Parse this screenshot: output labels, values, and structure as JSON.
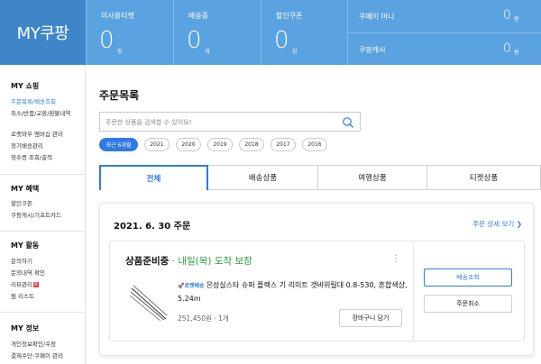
{
  "header": {
    "logo": "MY쿠팡",
    "stats": [
      {
        "label": "미사용티켓",
        "value": "0",
        "unit": "장"
      },
      {
        "label": "배송중",
        "value": "0",
        "unit": "개"
      },
      {
        "label": "할인쿠폰",
        "value": "0",
        "unit": "장"
      }
    ],
    "cash": [
      {
        "label": "쿠페이 머니",
        "value": "0",
        "unit": "원"
      },
      {
        "label": "쿠팡캐시",
        "value": "0",
        "unit": "원"
      }
    ]
  },
  "sidebar": {
    "sections": [
      {
        "title": "MY 쇼핑",
        "items": [
          "주문목록/배송조회",
          "취소/반품/교환/환불내역",
          "로켓와우 멤버십 관리",
          "정기배송관리",
          "영수증 조회/출력"
        ]
      },
      {
        "title": "MY 혜택",
        "items": [
          "할인쿠폰",
          "쿠팡캐시/기프트카드"
        ]
      },
      {
        "title": "MY 활동",
        "items": [
          "문의하기",
          "문의내역 확인",
          "리뷰관리",
          "찜 리스트"
        ]
      },
      {
        "title": "MY 정보",
        "items": [
          "개인정보확인/수정",
          "결제수단·쿠페이 관리"
        ]
      }
    ],
    "new_badge": "N"
  },
  "main": {
    "title": "주문목록",
    "search": {
      "placeholder": "주문한 상품을 검색할 수 있어요!",
      "value": ""
    },
    "periods": [
      "최근 6개월",
      "2021",
      "2020",
      "2019",
      "2018",
      "2017",
      "2016"
    ],
    "tabs": [
      "전체",
      "배송상품",
      "여행상품",
      "티켓상품"
    ],
    "order": {
      "date": "2021. 6. 30 주문",
      "detail_link": "주문 상세 보기 ❯",
      "status_bold": "상품준비중",
      "status_sep": " · ",
      "status_green": "내일(목) 도착 보장",
      "kebab": "⋮",
      "rocket": "🚀로켓배송",
      "product_name": "은성실스타 슈퍼 플렉스 기 리미트 갯바위릴대 0.8-530, 혼합색상, 5.24m",
      "price": "251,450원 · 1개",
      "cart_button": "장바구니 담기",
      "track_button": "배송조회",
      "cancel_button": "주문취소"
    }
  },
  "colors": {
    "accent": "#2f7ae5",
    "header": "#5aa2e0",
    "logo_bg": "#3f86c8",
    "arrival_green": "#2a9a3f"
  }
}
